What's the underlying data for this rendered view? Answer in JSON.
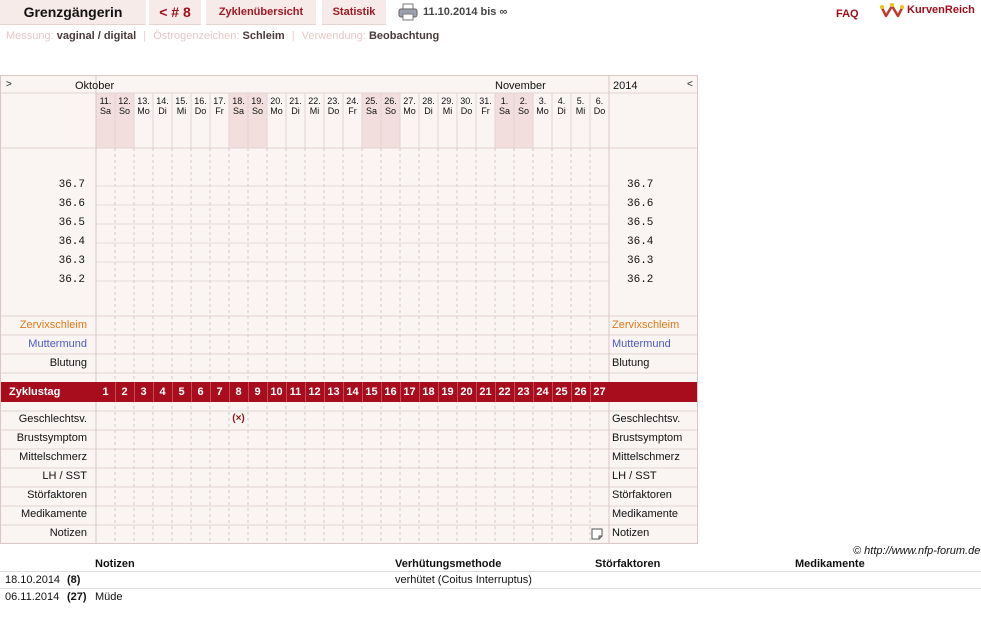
{
  "topbar": {
    "title": "Grenzgängerin",
    "prev_cycle": "< # 8",
    "overview": "Zyklenübersicht",
    "stats": "Statistik",
    "date_range": "11.10.2014 bis ∞",
    "faq": "FAQ",
    "logo_text": "KurvenReich",
    "icons": {
      "print": "printer-icon",
      "logo": "kurvenreich-logo"
    }
  },
  "meta": {
    "measure_label": "Messung:",
    "measure_value": "vaginal / digital",
    "estrogen_label": "Östrogenzeichen:",
    "estrogen_value": "Schleim",
    "usage_label": "Verwendung:",
    "usage_value": "Beobachtung",
    "separator": "|"
  },
  "chart": {
    "nav_left": ">",
    "nav_right": "<",
    "month_1": "Oktober",
    "month_2": "November",
    "year": "2014",
    "days": [
      {
        "n": "11.",
        "d": "Sa",
        "we": true
      },
      {
        "n": "12.",
        "d": "So",
        "we": true
      },
      {
        "n": "13.",
        "d": "Mo"
      },
      {
        "n": "14.",
        "d": "Di"
      },
      {
        "n": "15.",
        "d": "Mi"
      },
      {
        "n": "16.",
        "d": "Do"
      },
      {
        "n": "17.",
        "d": "Fr"
      },
      {
        "n": "18.",
        "d": "Sa",
        "we": true
      },
      {
        "n": "19.",
        "d": "So",
        "we": true
      },
      {
        "n": "20.",
        "d": "Mo"
      },
      {
        "n": "21.",
        "d": "Di"
      },
      {
        "n": "22.",
        "d": "Mi"
      },
      {
        "n": "23.",
        "d": "Do"
      },
      {
        "n": "24.",
        "d": "Fr"
      },
      {
        "n": "25.",
        "d": "Sa",
        "we": true
      },
      {
        "n": "26.",
        "d": "So",
        "we": true
      },
      {
        "n": "27.",
        "d": "Mo"
      },
      {
        "n": "28.",
        "d": "Di"
      },
      {
        "n": "29.",
        "d": "Mi"
      },
      {
        "n": "30.",
        "d": "Do"
      },
      {
        "n": "31.",
        "d": "Fr"
      },
      {
        "n": "1.",
        "d": "Sa",
        "we": true
      },
      {
        "n": "2.",
        "d": "So",
        "we": true
      },
      {
        "n": "3.",
        "d": "Mo"
      },
      {
        "n": "4.",
        "d": "Di"
      },
      {
        "n": "5.",
        "d": "Mi"
      },
      {
        "n": "6.",
        "d": "Do"
      }
    ],
    "temps": [
      "36.7",
      "36.6",
      "36.5",
      "36.4",
      "36.3",
      "36.2"
    ],
    "row_zervix": "Zervixschleim",
    "row_muttermund": "Muttermund",
    "row_blutung": "Blutung",
    "zyklus_label": "Zyklustag",
    "zyklus_days": [
      "1",
      "2",
      "3",
      "4",
      "5",
      "6",
      "7",
      "8",
      "9",
      "10",
      "11",
      "12",
      "13",
      "14",
      "15",
      "16",
      "17",
      "18",
      "19",
      "20",
      "21",
      "22",
      "23",
      "24",
      "25",
      "26",
      "27"
    ],
    "rows_bottom": [
      "Geschlechtsv.",
      "Brustsymptom",
      "Mittelschmerz",
      "LH / SST",
      "Störfaktoren",
      "Medikamente",
      "Notizen"
    ],
    "marker": "(×)",
    "colors": {
      "weekend": "#f2dfdd",
      "zyklus_bar": "#a80d1d",
      "accent": "#a10e1b"
    }
  },
  "copyright": "© http://www.nfp-forum.de",
  "notes": {
    "headers": [
      "Notizen",
      "Verhütungsmethode",
      "Störfaktoren",
      "Medikamente"
    ],
    "rows": [
      {
        "date": "18.10.2014",
        "day": "(8)",
        "note": "",
        "method": "verhütet (Coitus Interruptus)"
      },
      {
        "date": "06.11.2014",
        "day": "(27)",
        "note": "Müde",
        "method": ""
      }
    ]
  }
}
